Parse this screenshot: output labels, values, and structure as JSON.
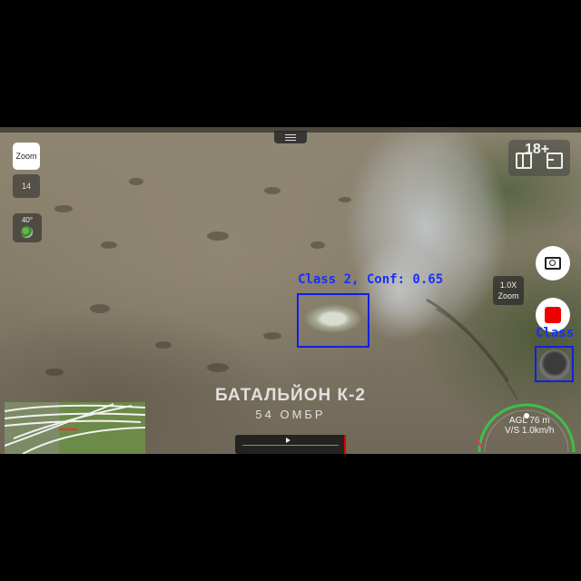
{
  "hud": {
    "zoom_button_label": "Zoom",
    "zoom_value": "14",
    "camera_angle": "40°",
    "age_rating": "18+",
    "zoom_level_value": "1.0X",
    "zoom_level_label": "Zoom",
    "agl": "AGL 76 m",
    "vs": "V/S 1.0km/h"
  },
  "watermark": {
    "title": "БАТАЛЬЙОН К-2",
    "subtitle": "54 ОМБР"
  },
  "detections": [
    {
      "label": "Class 2, Conf: 0.65",
      "color": "#1020e0"
    },
    {
      "label": "Class",
      "color": "#1020e0"
    }
  ],
  "colors": {
    "record": "#e00000",
    "detection": "#1020e0",
    "gauge": "#3fbf4a"
  },
  "icons": [
    "camera-icon",
    "record-icon",
    "layout-split-icon",
    "layout-grid-icon",
    "play-icon"
  ]
}
